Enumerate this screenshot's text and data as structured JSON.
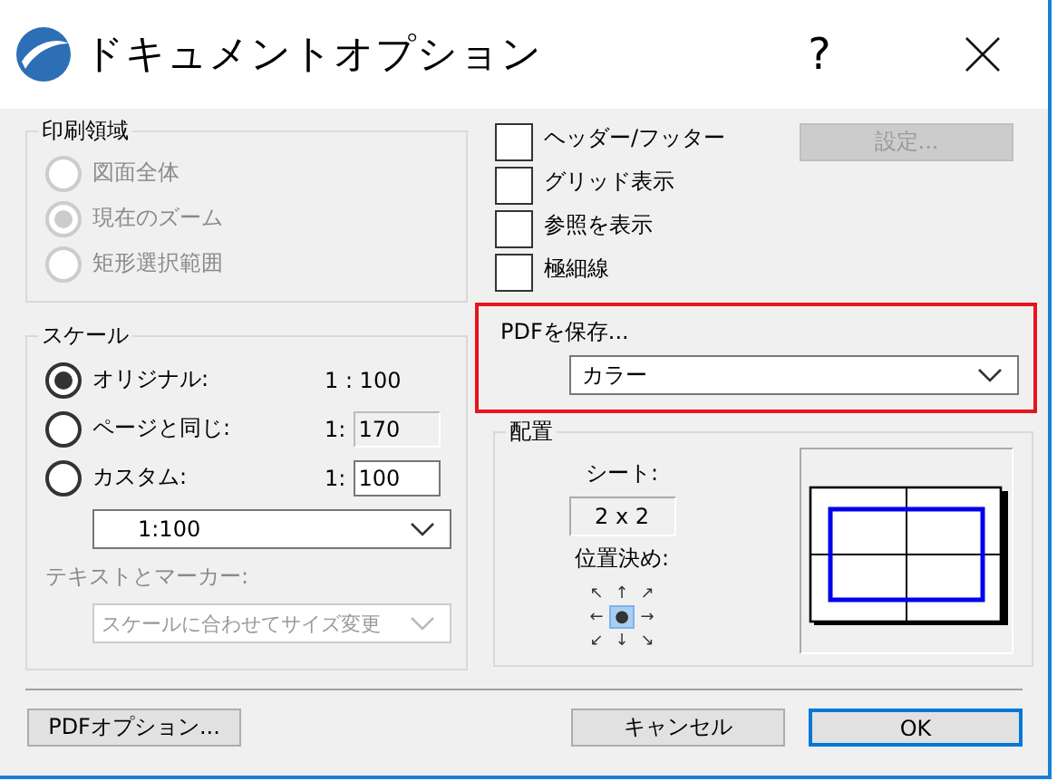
{
  "window": {
    "title": "ドキュメントオプション",
    "help": "?"
  },
  "print_area": {
    "label": "印刷領域",
    "disabled": true,
    "options": [
      {
        "label": "図面全体",
        "selected": false
      },
      {
        "label": "現在のズーム",
        "selected": true
      },
      {
        "label": "矩形選択範囲",
        "selected": false
      }
    ]
  },
  "scale": {
    "label": "スケール",
    "options": [
      {
        "kind": "text",
        "label": "オリジナル:",
        "value": "1 : 100",
        "selected": true
      },
      {
        "kind": "field",
        "label": "ページと同じ:",
        "prefix": "1:",
        "value": "170",
        "disabled": true,
        "selected": false
      },
      {
        "kind": "field",
        "label": "カスタム:",
        "prefix": "1:",
        "value": "100",
        "disabled": false,
        "selected": false
      }
    ],
    "select": "1:100",
    "text_markers": {
      "label": "テキストとマーカー:",
      "value": "スケールに合わせてサイズ変更",
      "disabled": true
    }
  },
  "options": [
    {
      "label": "ヘッダー/フッター",
      "checked": false
    },
    {
      "label": "グリッド表示",
      "checked": false
    },
    {
      "label": "参照を表示",
      "checked": false
    },
    {
      "label": "極細線",
      "checked": false
    }
  ],
  "settings_button": {
    "label": "設定...",
    "disabled": true
  },
  "save_pdf": {
    "label": "PDFを保存...",
    "value": "カラー",
    "highlighted": true
  },
  "placement": {
    "label": "配置",
    "sheet_label": "シート:",
    "sheet_value": "2 x 2",
    "position_label": "位置決め:",
    "positions": [
      {
        "symbol": "↖",
        "selected": false
      },
      {
        "symbol": "↑",
        "selected": false
      },
      {
        "symbol": "↗",
        "selected": false
      },
      {
        "symbol": "←",
        "selected": false
      },
      {
        "symbol": "●",
        "selected": true
      },
      {
        "symbol": "→",
        "selected": false
      },
      {
        "symbol": "↙",
        "selected": false
      },
      {
        "symbol": "↓",
        "selected": false
      },
      {
        "symbol": "↘",
        "selected": false
      }
    ]
  },
  "buttons": [
    {
      "label": "PDFオプション...",
      "default": false
    },
    {
      "label": "キャンセル",
      "default": false
    },
    {
      "label": "OK",
      "default": true
    }
  ]
}
